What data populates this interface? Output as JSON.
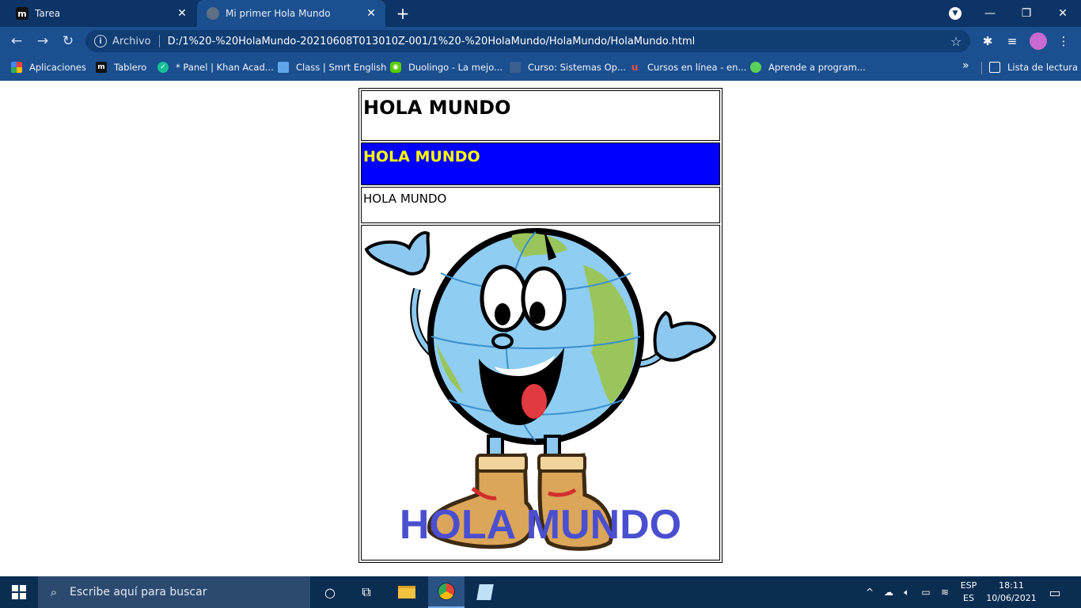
{
  "browser": {
    "tabs": [
      {
        "title": "Tarea",
        "favicon": "m-logo-icon",
        "active": false
      },
      {
        "title": "Mi primer Hola Mundo",
        "favicon": "globe-icon",
        "active": true
      }
    ],
    "address": {
      "scheme_label": "Archivo",
      "url": "D:/1%20-%20HolaMundo-20210608T013010Z-001/1%20-%20HolaMundo/HolaMundo/HolaMundo.html"
    },
    "bookmarks": [
      {
        "label": "Aplicaciones",
        "icon": "apps-grid-icon"
      },
      {
        "label": "Tablero",
        "icon": "m-logo-icon"
      },
      {
        "label": "* Panel | Khan Acad...",
        "icon": "khan-icon"
      },
      {
        "label": "Class | Smrt English",
        "icon": "book-icon"
      },
      {
        "label": "Duolingo - La mejo...",
        "icon": "duolingo-icon"
      },
      {
        "label": "Curso: Sistemas Op...",
        "icon": "course-icon"
      },
      {
        "label": "Cursos en línea - en...",
        "icon": "u-icon"
      },
      {
        "label": "Aprende a program...",
        "icon": "lizard-icon"
      }
    ],
    "reading_list": "Lista de lectura"
  },
  "page": {
    "row1": "HOLA MUNDO",
    "row2": "HOLA MUNDO",
    "row3": "HOLA MUNDO",
    "image_caption": "HOLA MUNDO",
    "row2_bg": "#0000ff",
    "row2_fg": "#ffff00",
    "caption_color": "#4a4fd0"
  },
  "taskbar": {
    "search_placeholder": "Escribe aquí para buscar",
    "lang_top": "ESP",
    "lang_bottom": "ES",
    "time": "18:11",
    "date": "10/06/2021"
  }
}
